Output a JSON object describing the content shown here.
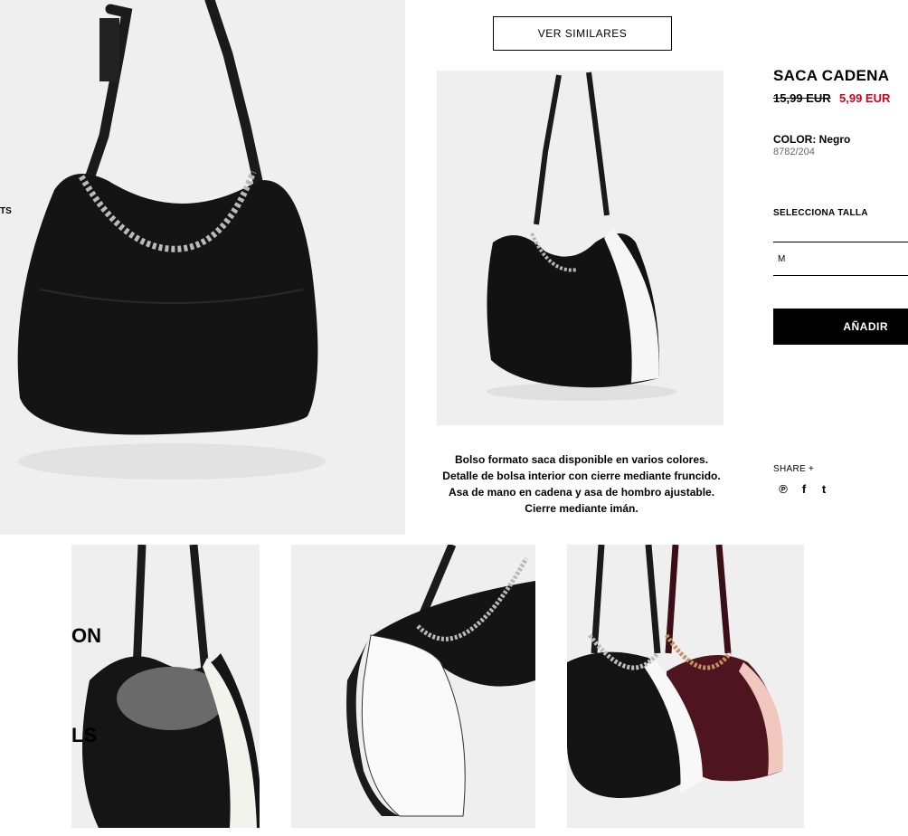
{
  "actions": {
    "see_similar": "VER SIMILARES",
    "add": "AÑADIR"
  },
  "product": {
    "name": "SACA CADENA",
    "price_old": "15,99 EUR",
    "price_new": "5,99 EUR",
    "color_label": "COLOR: Negro",
    "reference": "8782/204",
    "size_label": "SELECCIONA TALLA",
    "size_selected": "M",
    "description": "Bolso formato saca disponible en varios colores. Detalle de bolsa interior con cierre mediante fruncido. Asa de mano en cadena y asa de hombro ajustable. Cierre mediante imán."
  },
  "share": {
    "label": "SHARE +",
    "icons": [
      "pinterest-icon",
      "facebook-icon",
      "twitter-icon"
    ],
    "glyphs": [
      "℗",
      "f",
      "t"
    ]
  },
  "side_fragments": {
    "frag1": "TS",
    "frag2": "ON",
    "frag3": "LS"
  },
  "colors": {
    "sale_red": "#d0021b",
    "image_bg": "#efefef"
  }
}
